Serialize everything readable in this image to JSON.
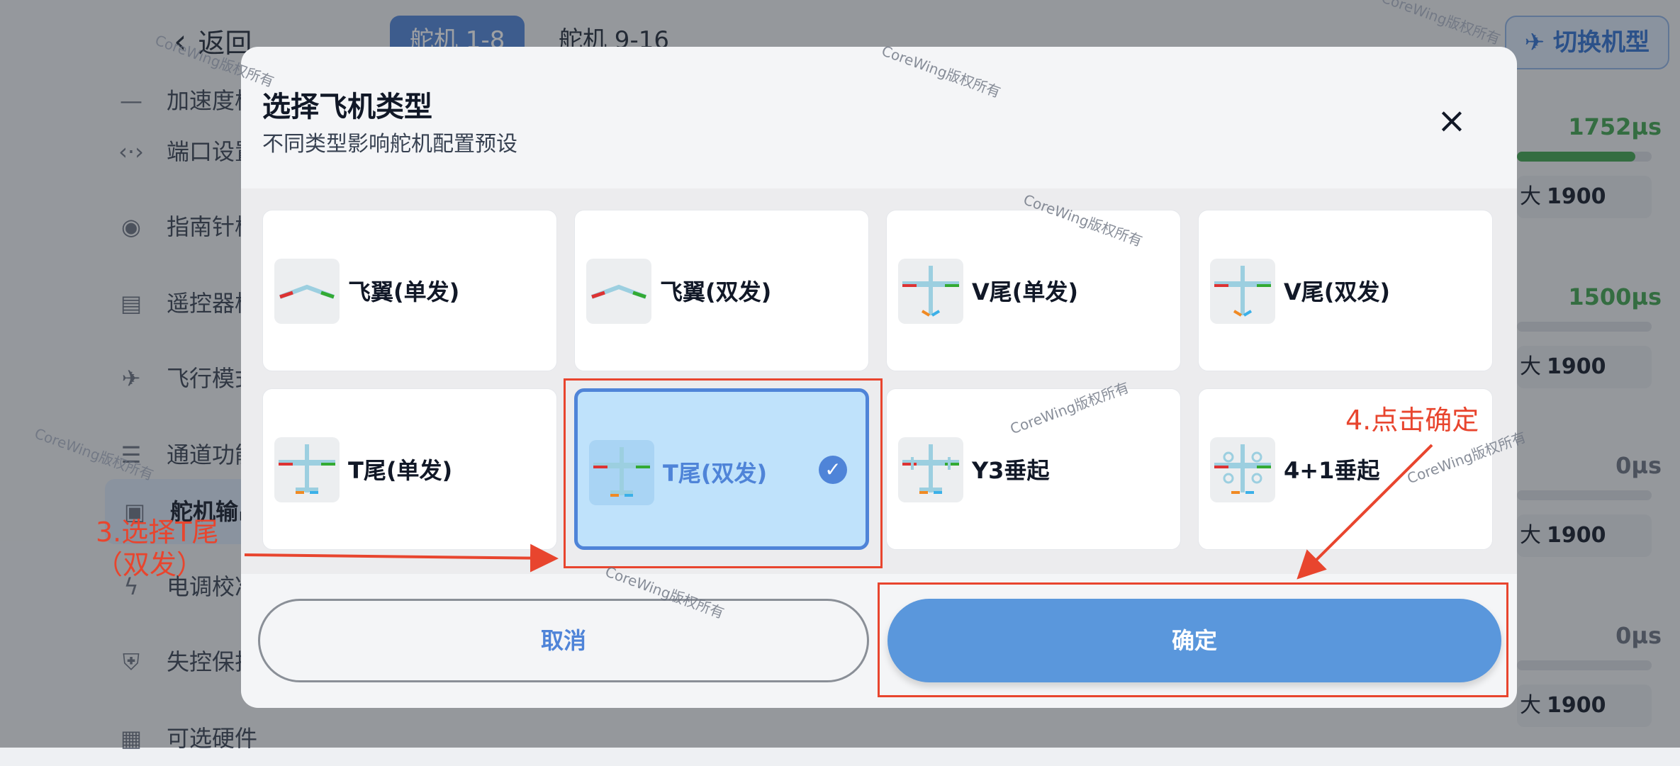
{
  "background": {
    "back_label": "返回",
    "tabs": [
      "舵机 1-8",
      "舵机 9-16"
    ],
    "switch_button": "切换机型",
    "sidebar": [
      {
        "label": "加速度校准",
        "icon": "dash-icon"
      },
      {
        "label": "端口设置",
        "icon": "code-arrows-icon"
      },
      {
        "label": "指南针校准",
        "icon": "compass-icon"
      },
      {
        "label": "遥控器校准",
        "icon": "radio-icon"
      },
      {
        "label": "飞行模式",
        "icon": "plane-icon"
      },
      {
        "label": "通道功能",
        "icon": "sliders-icon"
      },
      {
        "label": "舵机输出",
        "icon": "servo-icon"
      },
      {
        "label": "电调校准",
        "icon": "bolt-icon"
      },
      {
        "label": "失控保护",
        "icon": "shield-icon"
      },
      {
        "label": "可选硬件",
        "icon": "chip-icon"
      }
    ],
    "channels": [
      {
        "value": "1752µs",
        "max_label": "大",
        "max": "1900",
        "fill": 0.88
      },
      {
        "value": "1500µs",
        "max_label": "大",
        "max": "1900",
        "fill": 0.0
      },
      {
        "value": "0µs",
        "max_label": "大",
        "max": "1900",
        "fill": 0.0
      },
      {
        "value": "0µs",
        "max_label": "大",
        "max": "1900",
        "fill": 0.0
      }
    ]
  },
  "dialog": {
    "title": "选择飞机类型",
    "subtitle": "不同类型影响舵机配置预设",
    "types": [
      {
        "label": "飞翼(单发)",
        "icon": "flying-wing-icon",
        "selected": false
      },
      {
        "label": "飞翼(双发)",
        "icon": "flying-wing-icon",
        "selected": false
      },
      {
        "label": "V尾(单发)",
        "icon": "v-tail-plane-icon",
        "selected": false
      },
      {
        "label": "V尾(双发)",
        "icon": "v-tail-plane-icon",
        "selected": false
      },
      {
        "label": "T尾(单发)",
        "icon": "t-tail-plane-icon",
        "selected": false
      },
      {
        "label": "T尾(双发)",
        "icon": "t-tail-plane-icon",
        "selected": true
      },
      {
        "label": "Y3垂起",
        "icon": "y3-vtol-icon",
        "selected": false
      },
      {
        "label": "4+1垂起",
        "icon": "quadplane-vtol-icon",
        "selected": false
      }
    ],
    "cancel_label": "取消",
    "confirm_label": "确定"
  },
  "annotations": {
    "step3": "3.选择T尾（双发）",
    "step4": "4.点击确定"
  },
  "watermark": "CoreWing版权所有",
  "colors": {
    "accent": "#4f84d8",
    "annotation": "#e8452e",
    "selected_bg": "#bfe2fb",
    "ok_button": "#5a97dc"
  }
}
